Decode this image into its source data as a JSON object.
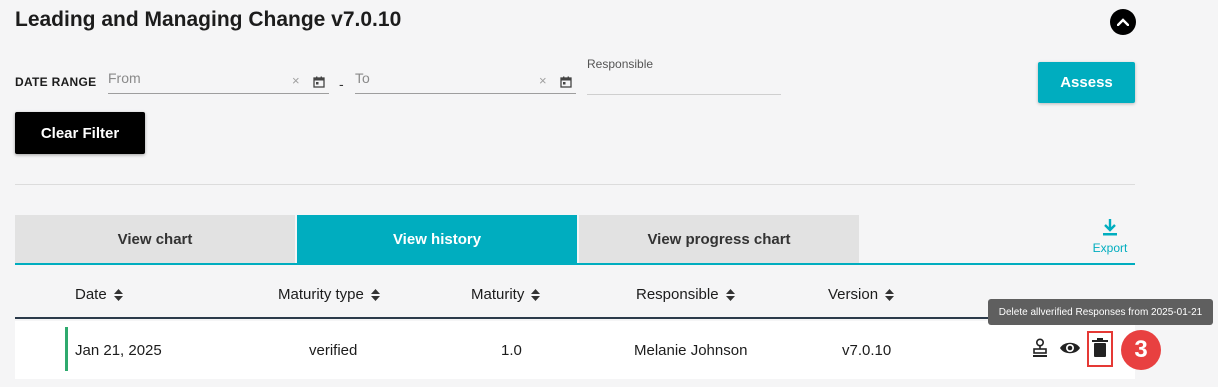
{
  "page": {
    "title": "Leading and Managing Change v7.0.10"
  },
  "filters": {
    "date_range_label": "DATE RANGE",
    "from_placeholder": "From",
    "to_placeholder": "To",
    "separator": "-",
    "clear_symbol": "×",
    "responsible_label": "Responsible",
    "responsible_value": ""
  },
  "buttons": {
    "assess": "Assess",
    "clear_filter": "Clear Filter"
  },
  "tabs": [
    {
      "label": "View chart",
      "active": false
    },
    {
      "label": "View history",
      "active": true
    },
    {
      "label": "View progress chart",
      "active": false
    }
  ],
  "export": {
    "label": "Export"
  },
  "table": {
    "columns": [
      "Date",
      "Maturity type",
      "Maturity",
      "Responsible",
      "Version"
    ],
    "rows": [
      {
        "date": "Jan 21, 2025",
        "maturity_type": "verified",
        "maturity": "1.0",
        "responsible": "Melanie Johnson",
        "version": "v7.0.10"
      }
    ]
  },
  "tooltip": {
    "text": "Delete allverified Responses from 2025-01-21"
  },
  "step_badge": {
    "number": "3"
  },
  "colors": {
    "accent": "#00adbf",
    "highlight": "#e53935",
    "badge": "#e84040",
    "row_accent": "#2eaa6e"
  },
  "icons": [
    "chevron-up-icon",
    "calendar-icon",
    "download-icon",
    "sort-icon",
    "stamp-icon",
    "eye-icon",
    "trash-icon"
  ]
}
